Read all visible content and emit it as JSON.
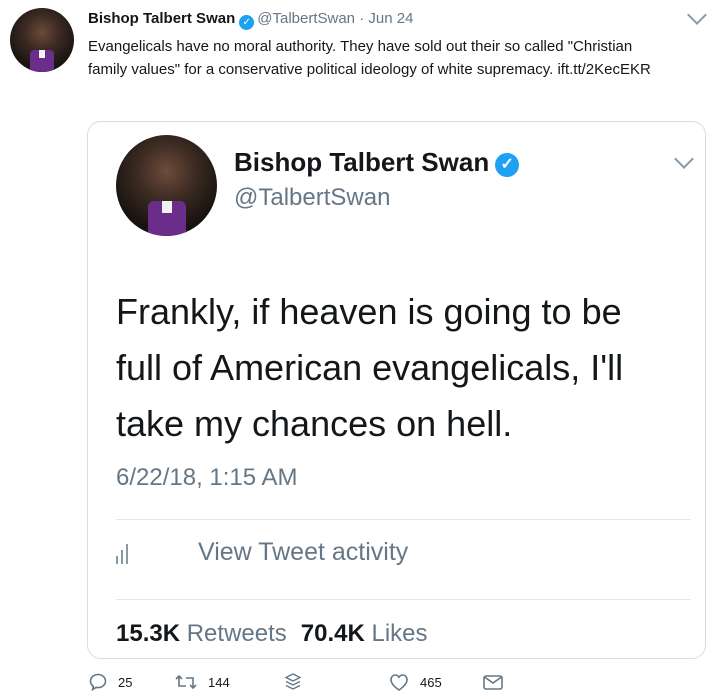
{
  "tweet": {
    "author_name": "Bishop Talbert Swan",
    "handle": "@TalbertSwan",
    "separator": "·",
    "date": "Jun 24",
    "text": "Evangelicals have no moral authority. They have sold out their so called \"Christian family values\" for a conservative political ideology of white supremacy.",
    "link": "ift.tt/2KecEKR"
  },
  "quoted": {
    "author_name": "Bishop Talbert Swan",
    "handle": "@TalbertSwan",
    "text": "Frankly, if heaven is going to be full of American evangelicals, I'll take my chances on hell.",
    "timestamp": "6/22/18, 1:15 AM",
    "activity_label": "View Tweet activity",
    "retweets_count": "15.3K",
    "retweets_label": "Retweets",
    "likes_count": "70.4K",
    "likes_label": "Likes"
  },
  "actions": {
    "replies": "25",
    "retweets": "144",
    "likes": "465"
  },
  "colors": {
    "verified": "#1da1f2",
    "muted": "#657786",
    "text": "#14171a",
    "border": "#d6dde3"
  },
  "icons": [
    "verified-badge-icon",
    "chevron-down-icon",
    "bar-chart-icon",
    "reply-icon",
    "retweet-icon",
    "stack-icon",
    "heart-icon",
    "message-icon"
  ]
}
